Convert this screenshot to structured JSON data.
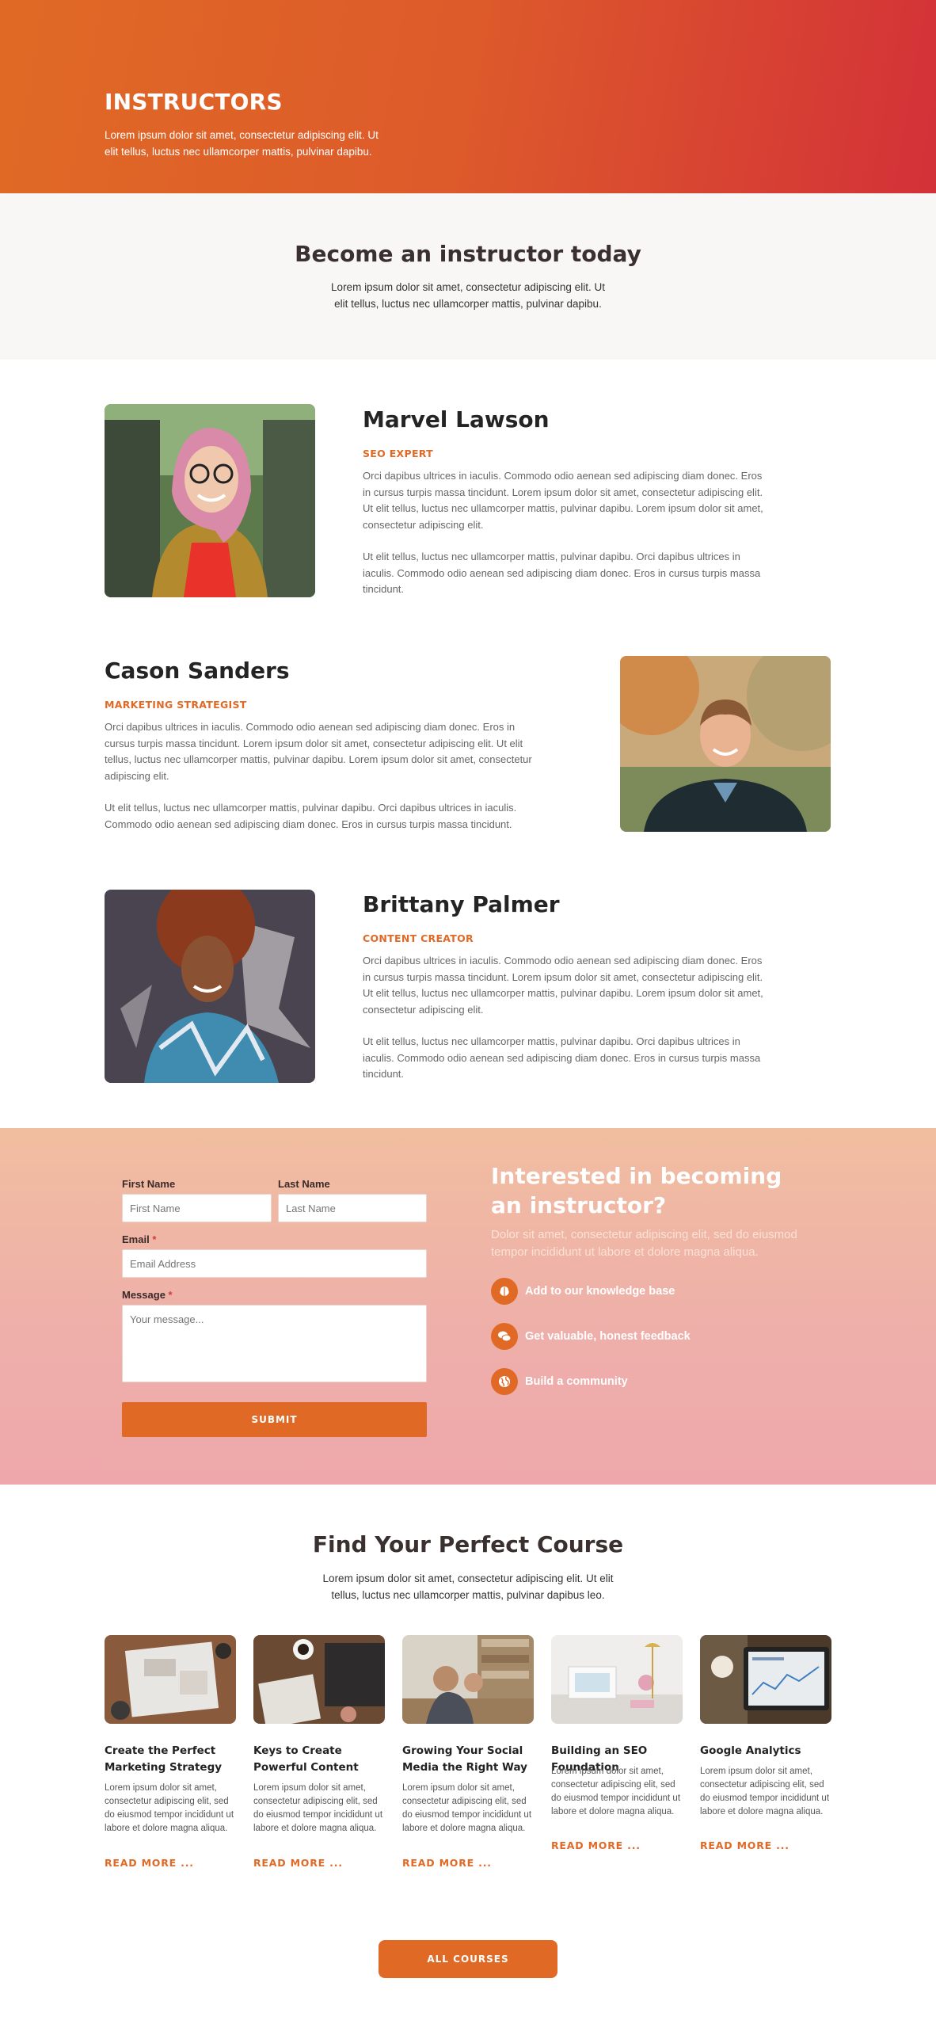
{
  "hero": {
    "title": "INSTRUCTORS",
    "subtitle": "Lorem ipsum dolor sit amet, consectetur adipiscing elit. Ut elit tellus, luctus nec ullamcorper mattis, pulvinar dapibu."
  },
  "become": {
    "title": "Become an instructor today",
    "subtitle": "Lorem ipsum dolor sit amet, consectetur adipiscing elit. Ut elit tellus, luctus nec ullamcorper mattis, pulvinar dapibu."
  },
  "instructors": [
    {
      "name": "Marvel Lawson",
      "role": "SEO EXPERT",
      "para1": "Orci dapibus ultrices in iaculis. Commodo odio aenean sed adipiscing diam donec. Eros in cursus turpis massa tincidunt. Lorem ipsum dolor sit amet, consectetur adipiscing elit. Ut elit tellus, luctus nec ullamcorper mattis, pulvinar dapibu. Lorem ipsum dolor sit amet, consectetur adipiscing elit.",
      "para2": "Ut elit tellus, luctus nec ullamcorper mattis, pulvinar dapibu. Orci dapibus ultrices in iaculis. Commodo odio aenean sed adipiscing diam donec. Eros in cursus turpis massa tincidunt."
    },
    {
      "name": "Cason Sanders",
      "role": "MARKETING STRATEGIST",
      "para1": "Orci dapibus ultrices in iaculis. Commodo odio aenean sed adipiscing diam donec. Eros in cursus turpis massa tincidunt. Lorem ipsum dolor sit amet, consectetur adipiscing elit. Ut elit tellus, luctus nec ullamcorper mattis, pulvinar dapibu. Lorem ipsum dolor sit amet, consectetur adipiscing elit.",
      "para2": "Ut elit tellus, luctus nec ullamcorper mattis, pulvinar dapibu. Orci dapibus ultrices in iaculis. Commodo odio aenean sed adipiscing diam donec. Eros in cursus turpis massa tincidunt."
    },
    {
      "name": "Brittany Palmer",
      "role": "CONTENT CREATOR",
      "para1": "Orci dapibus ultrices in iaculis. Commodo odio aenean sed adipiscing diam donec. Eros in cursus turpis massa tincidunt. Lorem ipsum dolor sit amet, consectetur adipiscing elit. Ut elit tellus, luctus nec ullamcorper mattis, pulvinar dapibu. Lorem ipsum dolor sit amet, consectetur adipiscing elit.",
      "para2": "Ut elit tellus, luctus nec ullamcorper mattis, pulvinar dapibu. Orci dapibus ultrices in iaculis. Commodo odio aenean sed adipiscing diam donec. Eros in cursus turpis massa tincidunt."
    }
  ],
  "form": {
    "first_name_label": "First Name",
    "first_name_placeholder": "First Name",
    "last_name_label": "Last Name",
    "last_name_placeholder": "Last Name",
    "email_label": "Email",
    "email_placeholder": "Email Address",
    "message_label": "Message",
    "message_placeholder": "Your message...",
    "required_mark": "*",
    "submit_label": "SUBMIT"
  },
  "interested": {
    "title": "Interested in becoming an instructor?",
    "subtitle": "Dolor sit amet, consectetur adipiscing elit, sed do eiusmod tempor incididunt ut labore et dolore magna aliqua.",
    "features": [
      {
        "icon": "brain-icon",
        "label": "Add to our knowledge base"
      },
      {
        "icon": "chat-bubbles-icon",
        "label": "Get valuable, honest feedback"
      },
      {
        "icon": "globe-icon",
        "label": "Build a community"
      }
    ]
  },
  "courses": {
    "title": "Find Your Perfect Course",
    "subtitle": "Lorem ipsum dolor sit amet, consectetur adipiscing elit. Ut elit tellus, luctus nec ullamcorper mattis, pulvinar dapibus leo.",
    "read_more": "READ MORE ...",
    "all_courses_label": "ALL COURSES",
    "cards": [
      {
        "title": "Create the Perfect Marketing Strategy",
        "desc": "Lorem ipsum dolor sit amet, consectetur adipiscing elit, sed do eiusmod tempor incididunt ut labore et dolore magna aliqua."
      },
      {
        "title": "Keys to Create Powerful Content",
        "desc": "Lorem ipsum dolor sit amet, consectetur adipiscing elit, sed do eiusmod tempor incididunt ut labore et dolore magna aliqua."
      },
      {
        "title": "Growing Your Social Media the Right Way",
        "desc": "Lorem ipsum dolor sit amet, consectetur adipiscing elit, sed do eiusmod tempor incididunt ut labore et dolore magna aliqua."
      },
      {
        "title": "Building an SEO Foundation",
        "desc": "Lorem ipsum dolor sit amet, consectetur adipiscing elit, sed do eiusmod tempor incididunt ut labore et dolore magna aliqua."
      },
      {
        "title": "Google Analytics",
        "desc": "Lorem ipsum dolor sit amet, consectetur adipiscing elit, sed do eiusmod tempor incididunt ut labore et dolore magna aliqua."
      }
    ]
  },
  "colors": {
    "accent": "#e06a25",
    "hero_gradient_start": "#e06a25",
    "hero_gradient_end": "#d33138",
    "form_bg_top": "#f1bea0",
    "form_bg_bottom": "#eea8ab"
  }
}
